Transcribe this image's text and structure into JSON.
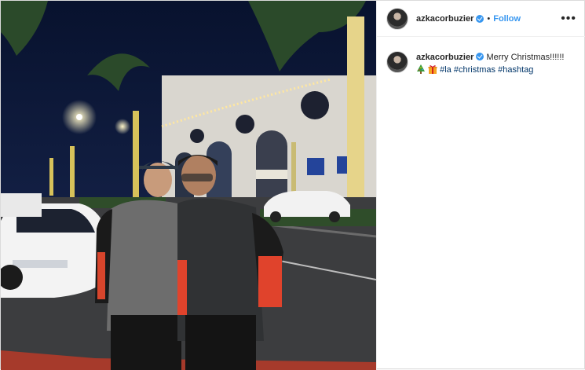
{
  "post": {
    "username": "azkacorbuzier",
    "follow_label": "Follow",
    "dot": "•",
    "more_label": "•••",
    "caption": {
      "text": "Merry Christmas!!!!!!",
      "emojis": [
        "christmas-tree-emoji",
        "gift-emoji"
      ],
      "hashtags": [
        "#la",
        "#christmas",
        "#hashtag"
      ]
    }
  },
  "colors": {
    "accent": "#3897f0",
    "hashtag": "#003569",
    "text": "#262626"
  },
  "photo": {
    "description_icon": "photo-two-men-night-street-christmas-lights"
  }
}
